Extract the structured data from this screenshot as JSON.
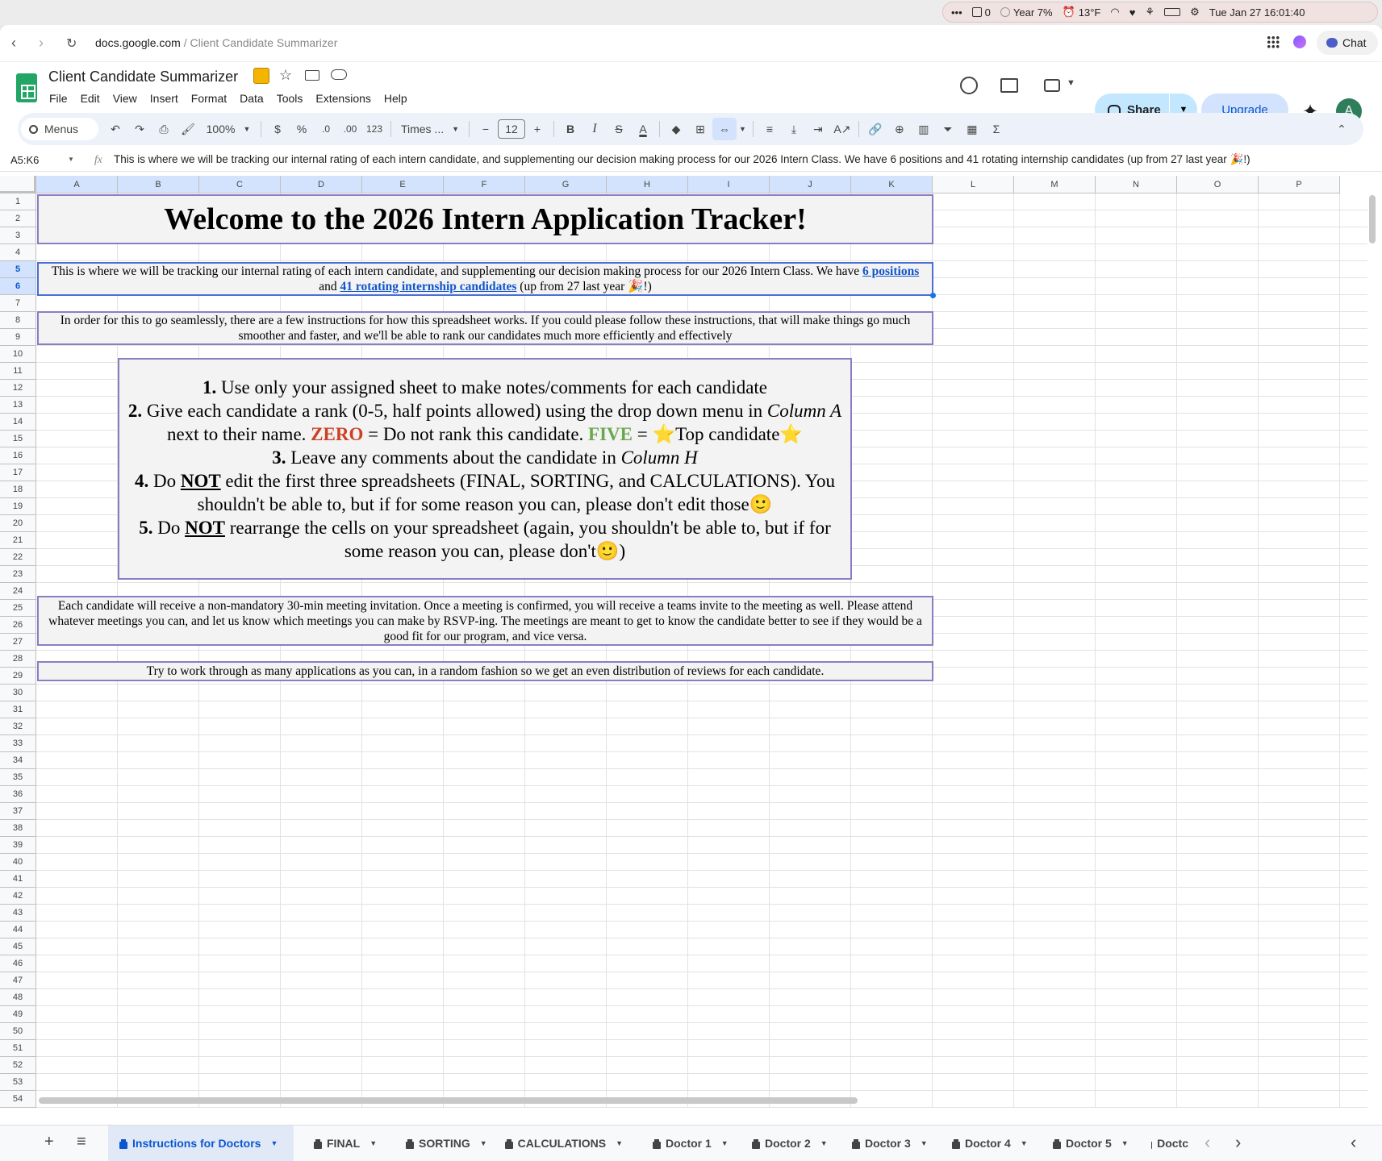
{
  "menubar": {
    "dots": "•••",
    "count": "0",
    "year": "Year 7%",
    "weather": "13°F",
    "datetime": "Tue Jan 27  16:01:40"
  },
  "browser": {
    "domain": "docs.google.com",
    "path": " / Client Candidate Summarizer",
    "chat_label": "Chat"
  },
  "doc": {
    "title": "Client Candidate Summarizer",
    "menus": [
      "File",
      "Edit",
      "View",
      "Insert",
      "Format",
      "Data",
      "Tools",
      "Extensions",
      "Help"
    ],
    "share_label": "Share",
    "upgrade_label": "Upgrade",
    "avatar_letter": "A"
  },
  "toolbar": {
    "search_label": "Menus",
    "zoom": "100%",
    "currency": "$",
    "percent": "%",
    "dec_less": ".0",
    "dec_more": ".00",
    "number_format": "123",
    "font": "Times ...",
    "font_size": "12",
    "bold": "B",
    "italic": "I",
    "strike": "S",
    "text_color": "A",
    "sigma": "Σ"
  },
  "formula_bar": {
    "name_box": "A5:K6",
    "fx": "fx",
    "content": "This is where we will be tracking our internal rating of each intern candidate, and supplementing our decision making process for our 2026 Intern Class. We have 6 positions and 41 rotating internship candidates (up from 27 last year 🎉!)"
  },
  "columns": [
    "A",
    "B",
    "C",
    "D",
    "E",
    "F",
    "G",
    "H",
    "I",
    "J",
    "K",
    "L",
    "M",
    "N",
    "O",
    "P"
  ],
  "rows": [
    "1",
    "2",
    "3",
    "4",
    "5",
    "6",
    "7",
    "8",
    "9",
    "10",
    "11",
    "12",
    "13",
    "14",
    "15",
    "16",
    "17",
    "18",
    "19",
    "20",
    "21",
    "22",
    "23",
    "24",
    "25",
    "26",
    "27",
    "28",
    "29",
    "30",
    "31",
    "32",
    "33",
    "34",
    "35",
    "36",
    "37",
    "38",
    "39",
    "40",
    "41",
    "42",
    "43",
    "44",
    "45",
    "46",
    "47",
    "48",
    "49",
    "50",
    "51",
    "52",
    "53",
    "54"
  ],
  "sheet": {
    "title": "Welcome to the 2026 Intern Application Tracker!",
    "intro_1": "This is where we will be tracking our internal rating of each intern candidate, and supplementing our decision making process for our 2026 Intern Class. We have ",
    "intro_link_1": "6 positions",
    "intro_2": " and ",
    "intro_link_2": "41 rotating internship candidates",
    "intro_3": " (up from 27 last year 🎉!)",
    "instructions_intro": "In order for this to go seamlessly, there are a few instructions for how this spreadsheet works. If you could please follow these instructions, that will make things go much smoother and faster, and we'll be able to rank our candidates much more efficiently and effectively",
    "steps": {
      "s1_num": "1.",
      "s1_text": " Use only your assigned sheet to make notes/comments for each candidate",
      "s2_num": "2.",
      "s2_text": " Give each candidate a rank (0-5, half points allowed) using the drop down menu in ",
      "s2_col": "Column A",
      "s2_mid": " next to their name. ",
      "s2_zero": "ZERO",
      "s2_zero_text": " = Do not rank this candidate. ",
      "s2_five": "FIVE",
      "s2_five_text": " = ⭐Top candidate⭐",
      "s3_num": "3.",
      "s3_text": " Leave any comments about the candidate in ",
      "s3_col": "Column H",
      "s4_num": "4.",
      "s4_a": " Do ",
      "s4_not": "NOT",
      "s4_b": " edit the first three spreadsheets (FINAL, SORTING, and CALCULATIONS). You shouldn't be able to, but if for some reason you can, please don't edit those🙂",
      "s5_num": "5.",
      "s5_a": " Do ",
      "s5_not": "NOT",
      "s5_b": " rearrange the cells on your spreadsheet (again, you shouldn't be able to, but if for some reason you can, please don't🙂)"
    },
    "meetings": "Each candidate will receive a non-mandatory 30-min meeting invitation. Once a meeting is confirmed, you will receive a teams invite to the meeting as well. Please attend whatever meetings you can, and let us know which meetings you can make by RSVP-ing. The meetings are meant to get to know the candidate better to see if they would be a good fit for our program, and vice versa.",
    "closing": "Try to work through as many applications as you can, in a random fashion so we get an even distribution of reviews for each candidate."
  },
  "tabs": [
    "Instructions for Doctors",
    "FINAL",
    "SORTING",
    "CALCULATIONS",
    "Doctor 1",
    "Doctor 2",
    "Doctor 3",
    "Doctor 4",
    "Doctor 5",
    "Doctc"
  ],
  "colors": {
    "accent": "#0b57d0",
    "box_border": "#8e7cc3",
    "zero": "#cc4125",
    "five": "#6aa84f",
    "link": "#1155cc"
  }
}
